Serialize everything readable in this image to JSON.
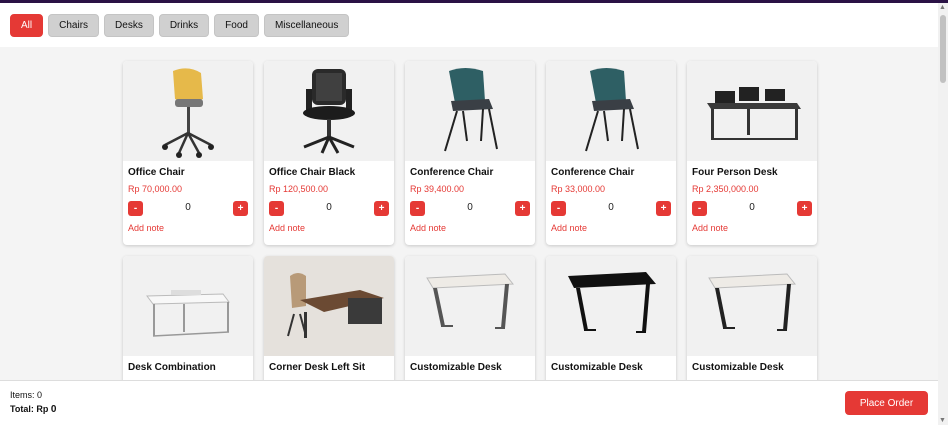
{
  "filters": [
    {
      "label": "All",
      "active": true
    },
    {
      "label": "Chairs",
      "active": false
    },
    {
      "label": "Desks",
      "active": false
    },
    {
      "label": "Drinks",
      "active": false
    },
    {
      "label": "Food",
      "active": false
    },
    {
      "label": "Miscellaneous",
      "active": false
    }
  ],
  "products": [
    {
      "name": "Office Chair",
      "price": "Rp 70,000.00",
      "qty": "0",
      "note": "Add note",
      "icon": "yellow-chair-image"
    },
    {
      "name": "Office Chair Black",
      "price": "Rp 120,500.00",
      "qty": "0",
      "note": "Add note",
      "icon": "black-office-chair-image"
    },
    {
      "name": "Conference Chair",
      "price": "Rp 39,400.00",
      "qty": "0",
      "note": "Add note",
      "icon": "teal-chair-image"
    },
    {
      "name": "Conference Chair",
      "price": "Rp 33,000.00",
      "qty": "0",
      "note": "Add note",
      "icon": "teal-chair-image"
    },
    {
      "name": "Four Person Desk",
      "price": "Rp 2,350,000.00",
      "qty": "0",
      "note": "Add note",
      "icon": "four-person-desk-image"
    },
    {
      "name": "Desk Combination",
      "icon": "desk-combination-image"
    },
    {
      "name": "Corner Desk Left Sit",
      "icon": "corner-desk-image"
    },
    {
      "name": "Customizable Desk",
      "icon": "white-desk-image"
    },
    {
      "name": "Customizable Desk",
      "icon": "black-desk-image"
    },
    {
      "name": "Customizable Desk",
      "icon": "white-desk-image"
    }
  ],
  "stepper": {
    "minus": "-",
    "plus": "+"
  },
  "footer": {
    "items_label": "Items: 0",
    "total_label": "Total: Rp ",
    "total_value": "0",
    "place_order": "Place Order"
  },
  "colors": {
    "accent": "#e53935",
    "chip": "#d0d0d0",
    "topbar": "#2a1245"
  }
}
